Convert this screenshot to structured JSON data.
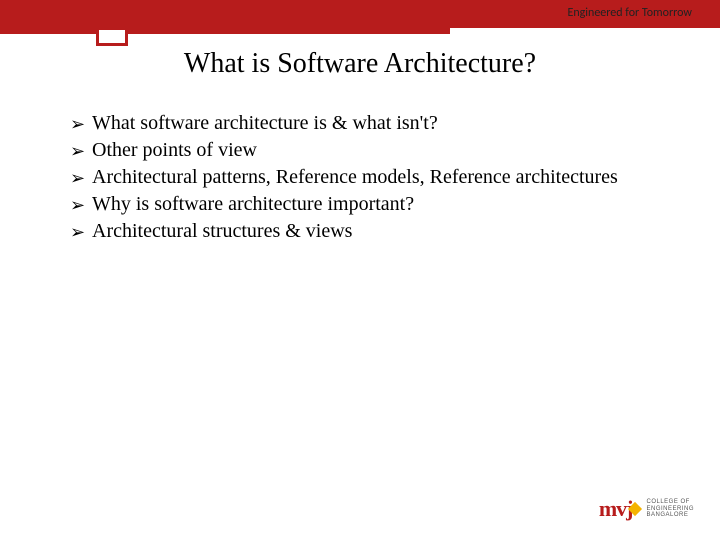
{
  "header": {
    "tagline": "Engineered for Tomorrow"
  },
  "title": "What is Software Architecture?",
  "bullets": [
    "What software architecture is & what isn't?",
    "Other points of view",
    "Architectural patterns, Reference models, Reference architectures",
    "Why is software architecture important?",
    "Architectural structures & views"
  ],
  "logo": {
    "mark": "mvj",
    "line1": "COLLEGE OF",
    "line2": "ENGINEERING",
    "line3": "BANGALORE"
  }
}
